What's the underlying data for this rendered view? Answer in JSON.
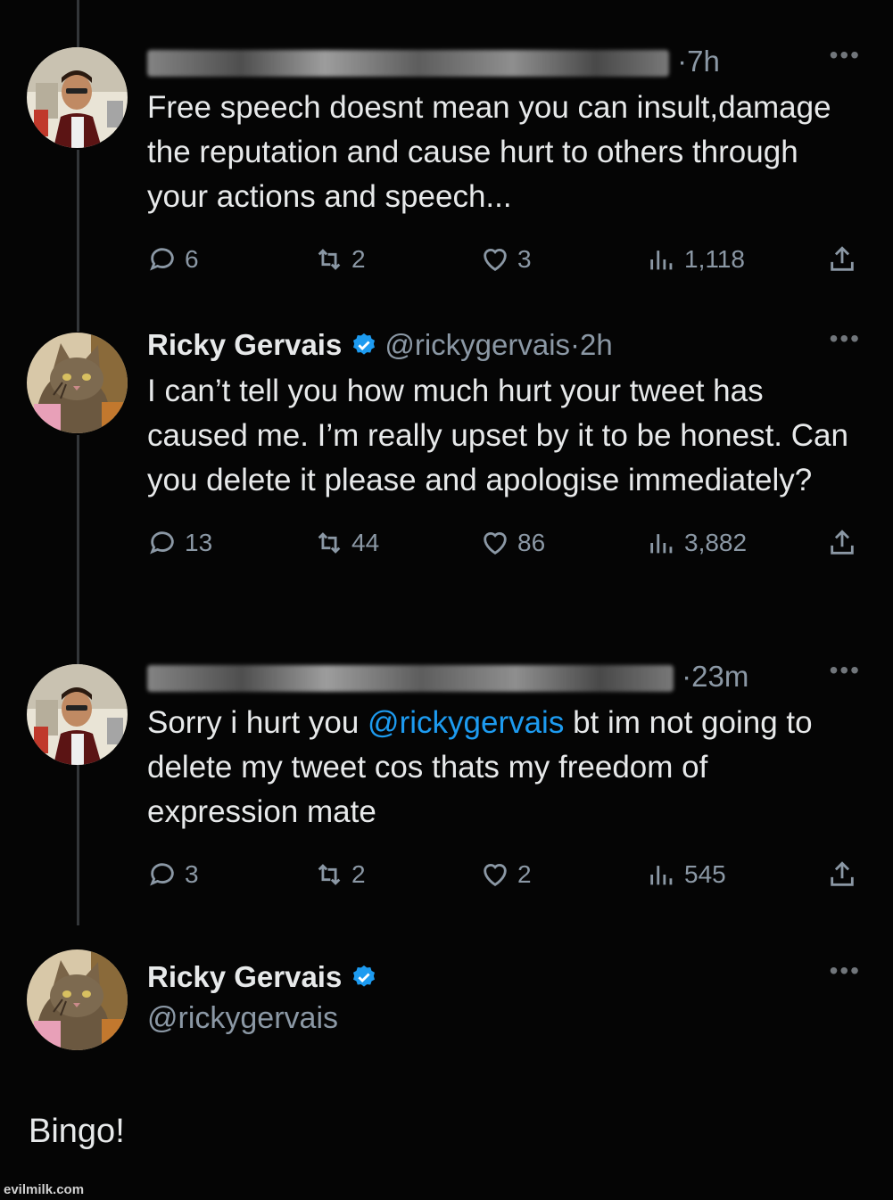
{
  "tweets": [
    {
      "author_name": "",
      "author_handle": "",
      "time": "7h",
      "text": "Free speech doesnt mean you can insult,damage the reputation and cause hurt to others through your actions and speech...",
      "replies": "6",
      "reposts": "2",
      "likes": "3",
      "views": "1,118",
      "verified": false,
      "avatar": "man-avatar"
    },
    {
      "author_name": "Ricky Gervais",
      "author_handle": "@rickygervais",
      "time": "2h",
      "text": "I can’t tell you how much hurt your tweet has caused me. I’m really upset by it to be honest. Can you delete it please and apologise immediately?",
      "replies": "13",
      "reposts": "44",
      "likes": "86",
      "views": "3,882",
      "verified": true,
      "avatar": "cat-avatar"
    },
    {
      "author_name": "",
      "author_handle": "",
      "time": "23m",
      "text_before": "Sorry i hurt you ",
      "mention": "@rickygervais",
      "text_after": " bt im not going to delete my tweet cos thats my freedom of expression mate",
      "replies": "3",
      "reposts": "2",
      "likes": "2",
      "views": "545",
      "verified": false,
      "avatar": "man-avatar"
    }
  ],
  "last": {
    "author_name": "Ricky Gervais",
    "author_handle": "@rickygervais",
    "verified": true,
    "avatar": "cat-avatar"
  },
  "caption": "Bingo!",
  "watermark": "evilmilk.com",
  "more_label": "•••",
  "time_sep": "·",
  "colors": {
    "background": "#050505",
    "text": "#e7e9ea",
    "muted": "#8b98a5",
    "link": "#1d9bf0",
    "verified": "#1d9bf0"
  }
}
